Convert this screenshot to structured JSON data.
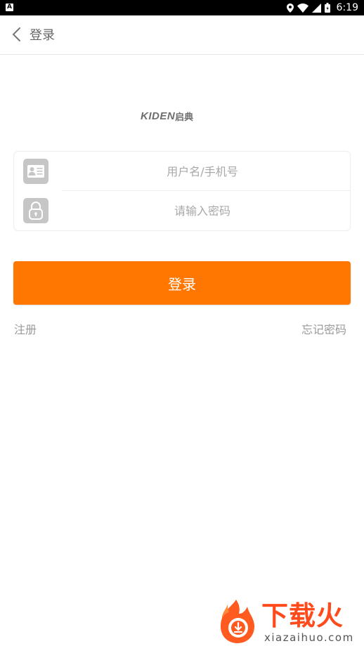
{
  "status_bar": {
    "notification_icon": "A",
    "time": "6:19",
    "icons": [
      "location-icon",
      "wifi-icon",
      "signal-icon",
      "battery-icon"
    ]
  },
  "header": {
    "title": "登录",
    "back_icon": "chevron-left-icon"
  },
  "logo": {
    "latin": "KIDEN",
    "cjk": "启典",
    "color": "#6e6e6e"
  },
  "form": {
    "username": {
      "value": "",
      "placeholder": "用户名/手机号",
      "icon": "id-card-icon"
    },
    "password": {
      "value": "",
      "placeholder": "请输入密码",
      "icon": "lock-icon"
    }
  },
  "login_button": {
    "label": "登录",
    "color": "#ff7700"
  },
  "links": {
    "register": "注册",
    "forgot_password": "忘记密码"
  },
  "watermark": {
    "cn": "下载火",
    "en": "xiazaihuo.com"
  }
}
